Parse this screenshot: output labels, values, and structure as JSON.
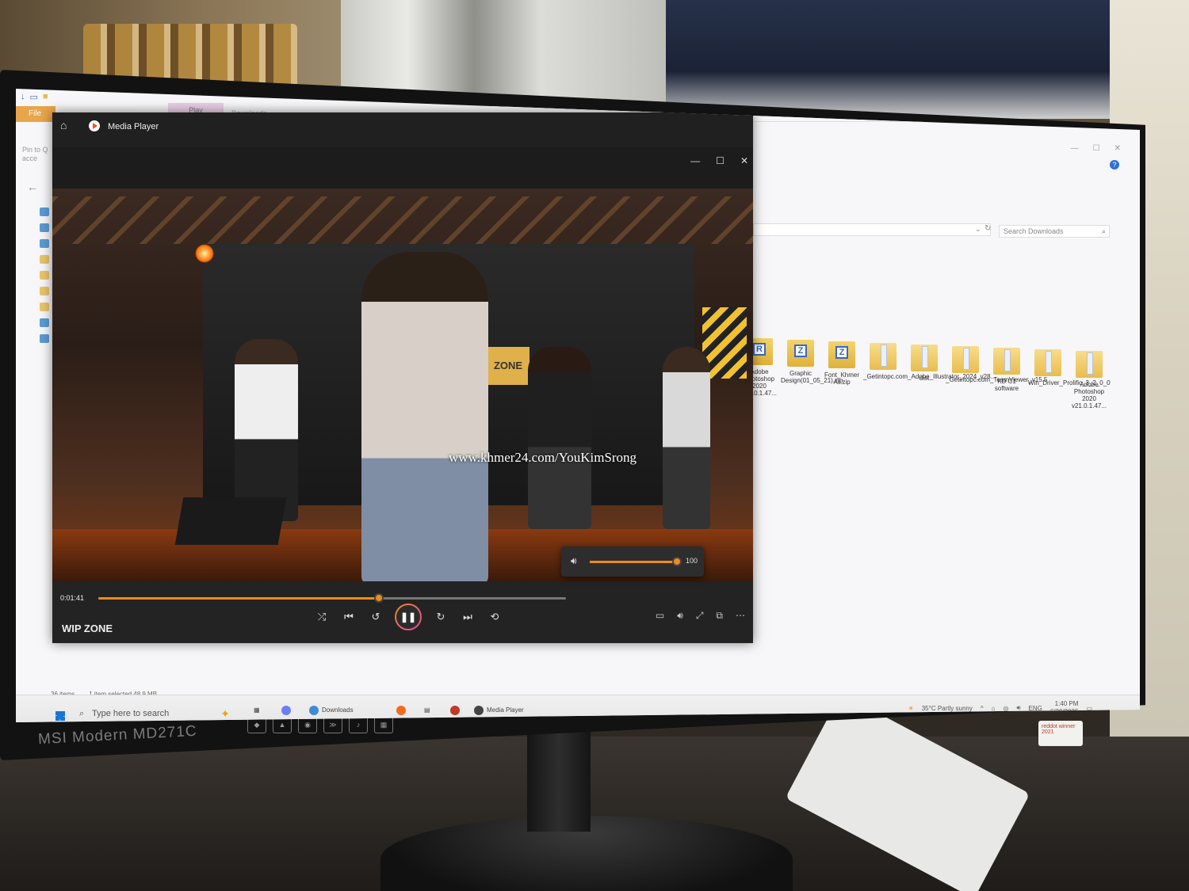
{
  "explorer": {
    "ribbon_tabs": {
      "file": "File",
      "play": "Play",
      "downloads": "Downloads"
    },
    "pin_label": "Pin to Q\nacce",
    "search_placeholder": "Search Downloads",
    "status": {
      "items": "36 items",
      "selected": "1 item selected  48.9 MB"
    },
    "files": [
      {
        "name": "Adobe Photoshop 2020 v21.0.1.47...",
        "icon": "zip-icon",
        "letter": "R"
      },
      {
        "name": "Graphic Design(01_05_21).zip",
        "icon": "zip-icon",
        "letter": "Z"
      },
      {
        "name": "Font_Khmer All.zip",
        "icon": "zip-icon",
        "letter": "Z"
      },
      {
        "name": "_Getintopc.com_Adobe_Illustrator_2024_v28...",
        "icon": "folder-icon"
      },
      {
        "name": "dist",
        "icon": "folder-icon"
      },
      {
        "name": "_Getintopc.com_TeamViewer_v15.5",
        "icon": "folder-icon"
      },
      {
        "name": "KD C1 software",
        "icon": "folder-icon"
      },
      {
        "name": "Win_Driver_Prolific_3_2_0_0",
        "icon": "folder-icon"
      },
      {
        "name": "Adobe Photoshop 2020 v21.0.1.47...",
        "icon": "folder-icon"
      }
    ]
  },
  "media_player": {
    "title": "Media Player",
    "track_title": "WIP ZONE",
    "elapsed": "0:01:41",
    "progress_fraction": 0.6,
    "volume": 100,
    "volume_label": "100",
    "watermark": "www.khmer24.com/YouKimSrong",
    "video_signs": {
      "zone": "ZONE"
    }
  },
  "taskbar": {
    "search_placeholder": "Type here to search",
    "downloads_app": "Downloads",
    "media_player_app": "Media Player",
    "weather": "35°C  Partly sunny",
    "language": "ENG",
    "time": "1:40 PM",
    "date": "6/20/2025"
  },
  "monitor": {
    "brand": "MSI  Modern MD271C",
    "award": "reddot winner 2021"
  }
}
